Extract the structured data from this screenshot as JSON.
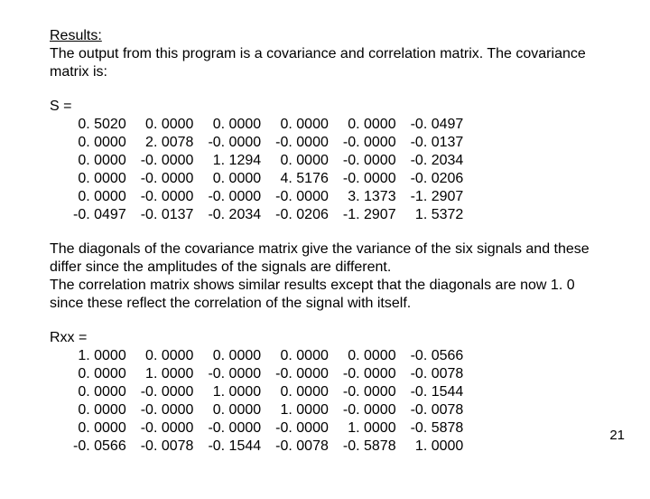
{
  "heading": "Results:",
  "intro": "The output from this program is a covariance and correlation matrix. The covariance matrix is:",
  "s_label": "S =",
  "s_matrix": [
    [
      "0. 5020",
      "0. 0000",
      "0. 0000",
      "0. 0000",
      "0. 0000",
      "-0. 0497"
    ],
    [
      "0. 0000",
      "2. 0078",
      "-0. 0000",
      "-0. 0000",
      "-0. 0000",
      "-0. 0137"
    ],
    [
      "0. 0000",
      "-0. 0000",
      "1. 1294",
      "0. 0000",
      "-0. 0000",
      "-0. 2034"
    ],
    [
      "0. 0000",
      "-0. 0000",
      "0. 0000",
      "4. 5176",
      "-0. 0000",
      "-0. 0206"
    ],
    [
      "0. 0000",
      "-0. 0000",
      "-0. 0000",
      "-0. 0000",
      "3. 1373",
      "-1. 2907"
    ],
    [
      "-0. 0497",
      "-0. 0137",
      "-0. 2034",
      "-0. 0206",
      "-1. 2907",
      "1. 5372"
    ]
  ],
  "mid_para": "The diagonals of the covariance matrix give the variance of the six signals and these differ since the amplitudes of the signals are different.\nThe correlation matrix shows similar results except that the diagonals are now 1. 0 since these reflect the correlation of the signal with itself.",
  "r_label": "Rxx =",
  "r_matrix": [
    [
      "1. 0000",
      "0. 0000",
      "0. 0000",
      "0. 0000",
      "0. 0000",
      "-0. 0566"
    ],
    [
      "0. 0000",
      "1. 0000",
      "-0. 0000",
      "-0. 0000",
      "-0. 0000",
      "-0. 0078"
    ],
    [
      "0. 0000",
      "-0. 0000",
      "1. 0000",
      "0. 0000",
      "-0. 0000",
      "-0. 1544"
    ],
    [
      "0. 0000",
      "-0. 0000",
      "0. 0000",
      "1. 0000",
      "-0. 0000",
      "-0. 0078"
    ],
    [
      "0. 0000",
      "-0. 0000",
      "-0. 0000",
      "-0. 0000",
      "1. 0000",
      "-0. 5878"
    ],
    [
      "-0. 0566",
      "-0. 0078",
      "-0. 1544",
      "-0. 0078",
      "-0. 5878",
      "1. 0000"
    ]
  ],
  "page_number": "21"
}
